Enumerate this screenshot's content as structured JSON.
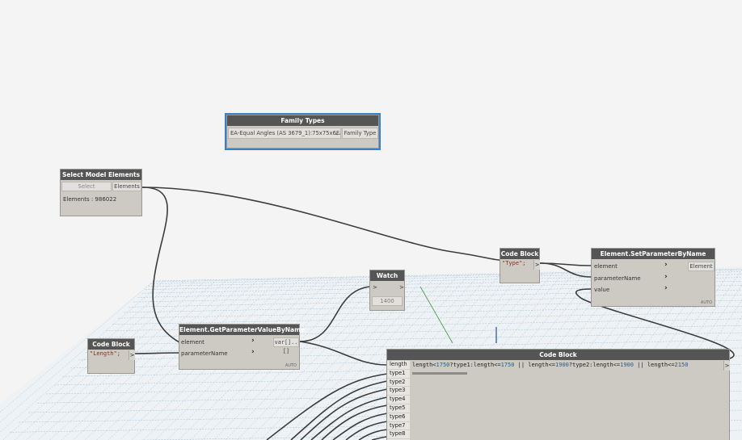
{
  "nodes": {
    "family_types": {
      "title": "Family Types",
      "selected_value": "EA-Equal Angles (AS 3679_1):75x75x6EA",
      "output_port": "Family Type"
    },
    "select_model_elements": {
      "title": "Select Model Elements",
      "select_button": "Select",
      "output_port": "Elements",
      "status": "Elements : 986022"
    },
    "code_block_length": {
      "title": "Code Block",
      "code": "\"Length\";",
      "output_port": ">"
    },
    "get_parameter": {
      "title": "Element.GetParameterValueByName",
      "input_element": "element",
      "input_param": "parameterName",
      "output_port": "var[]..[]",
      "lacing": "AUTO"
    },
    "watch": {
      "title": "Watch",
      "input_port": ">",
      "output_port": ">",
      "value": "1400"
    },
    "code_block_type": {
      "title": "Code Block",
      "code": "\"Type\";",
      "output_port": ">"
    },
    "set_parameter": {
      "title": "Element.SetParameterByName",
      "input_element": "element",
      "input_param": "parameterName",
      "input_value": "value",
      "output_port": "Element",
      "lacing": "AUTO"
    },
    "code_block_main": {
      "title": "Code Block",
      "ports": [
        "length",
        "type1",
        "type2",
        "type3",
        "type4",
        "type5",
        "type6",
        "type7",
        "type8",
        "type9"
      ],
      "code_parts": {
        "a": "length<",
        "b": "1750",
        "c": "?type1:length<=",
        "d": "1750",
        "e": " || length<=",
        "f": "1900",
        "g": "?type2:length<=",
        "h": "1900",
        "i": " || length<=",
        "j": "2150"
      },
      "output_port": ">"
    }
  },
  "colors": {
    "background": "#f4f4f4",
    "node_body": "#cdcac4",
    "node_header": "#555555",
    "wire": "#3c3c3c",
    "selection": "#3a82c6",
    "grid": "#8fb0c6"
  }
}
